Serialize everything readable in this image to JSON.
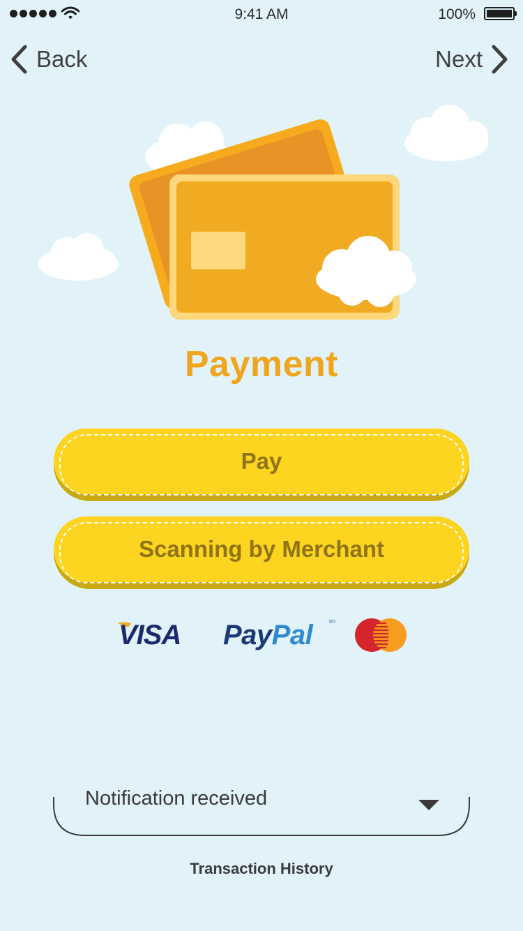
{
  "status_bar": {
    "time": "9:41 AM",
    "battery": "100%",
    "icons": [
      "signal-dots-icon",
      "wifi-icon",
      "battery-icon"
    ]
  },
  "nav": {
    "back_label": "Back",
    "next_label": "Next"
  },
  "hero": {
    "icons": [
      "credit-cards-illustration",
      "cloud-icon"
    ]
  },
  "page": {
    "title": "Payment"
  },
  "actions": {
    "pay_label": "Pay",
    "scan_label": "Scanning by Merchant"
  },
  "payment_methods": {
    "visa": "VISA",
    "paypal_pay": "Pay",
    "paypal_pal": "Pal",
    "paypal_tm": "tm",
    "mastercard": "mastercard-logo"
  },
  "notification": {
    "selected": "Notification received"
  },
  "footer": {
    "history_label": "Transaction History"
  },
  "colors": {
    "background": "#e1f3f8",
    "accent": "#f0a51e",
    "button": "#fdd41f",
    "button_text": "#8f7515",
    "visa_blue": "#1c2a6e",
    "paypal_dark": "#1d3a78",
    "paypal_light": "#2f8ad2",
    "mc_red": "#d4252b",
    "mc_orange": "#f69c1f"
  }
}
